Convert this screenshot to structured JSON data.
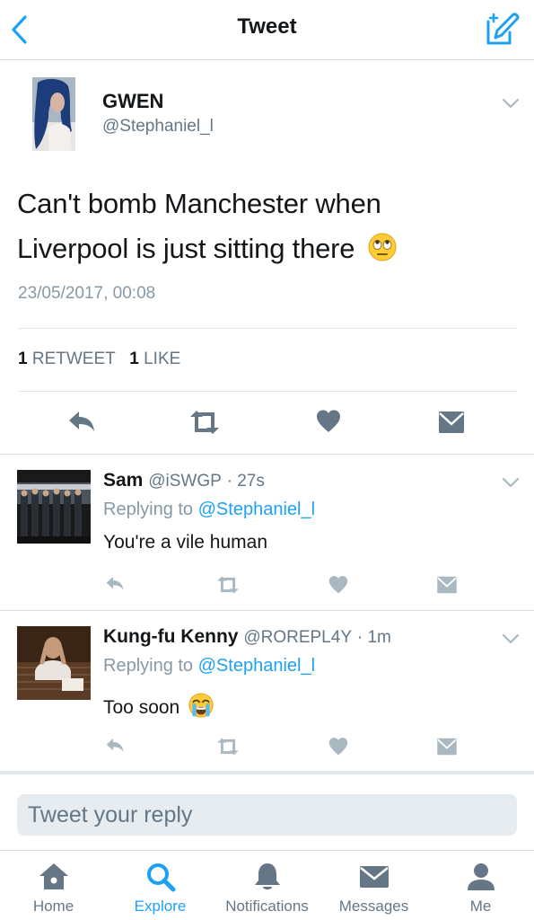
{
  "header": {
    "title": "Tweet",
    "back_icon": "chevron-left-icon",
    "compose_icon": "compose-icon",
    "accent": "#1da1f2"
  },
  "tweet": {
    "author_name": "GWEN",
    "author_handle": "@Stephaniel_l",
    "text_line1": "Can't bomb Manchester when",
    "text_line2": "Liverpool is just sitting there",
    "emoji": "eye-roll-emoji",
    "timestamp": "23/05/2017, 00:08",
    "retweets_count": "1",
    "retweets_label": "RETWEET",
    "likes_count": "1",
    "likes_label": "LIKE"
  },
  "replies": [
    {
      "name": "Sam",
      "handle": "@iSWGP",
      "time": "· 27s",
      "replying_prefix": "Replying to",
      "replying_to": "@Stephaniel_l",
      "text": "You're a vile human"
    },
    {
      "name": "Kung-fu Kenny",
      "handle": "@ROREPL4Y",
      "time": "· 1m",
      "replying_prefix": "Replying to",
      "replying_to": "@Stephaniel_l",
      "text": "Too soon",
      "emoji": "crying-emoji"
    }
  ],
  "reply_box": {
    "placeholder": "Tweet your reply"
  },
  "tabs": [
    {
      "label": "Home",
      "icon": "home-icon"
    },
    {
      "label": "Explore",
      "icon": "search-icon",
      "active": true
    },
    {
      "label": "Notifications",
      "icon": "bell-icon"
    },
    {
      "label": "Messages",
      "icon": "envelope-icon"
    },
    {
      "label": "Me",
      "icon": "person-icon"
    }
  ]
}
